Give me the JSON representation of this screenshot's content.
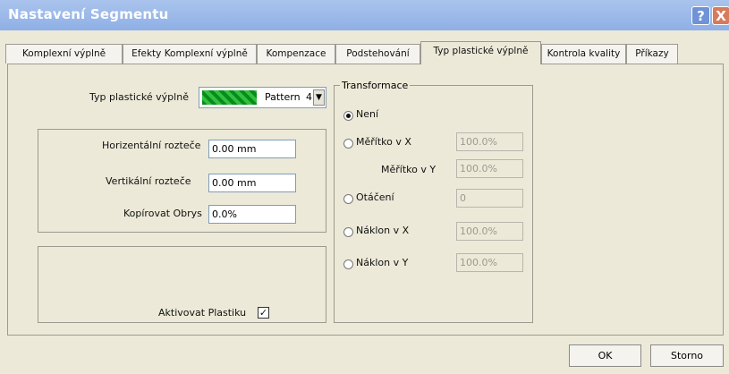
{
  "window": {
    "title": "Nastavení Segmentu",
    "help_label": "?",
    "close_label": "X"
  },
  "tabs": [
    {
      "label": "Komplexní výplně"
    },
    {
      "label": "Efekty Komplexní výplně"
    },
    {
      "label": "Kompenzace"
    },
    {
      "label": "Podstehování"
    },
    {
      "label": "Typ plastické výplně"
    },
    {
      "label": "Kontrola kvality"
    },
    {
      "label": "Příkazy"
    }
  ],
  "fill_type": {
    "label": "Typ plastické výplně",
    "value": "Pattern",
    "number": "4"
  },
  "spacing": {
    "horizontal_label": "Horizentální rozteče",
    "horizontal_value": "0.00 mm",
    "vertical_label": "Vertikální rozteče",
    "vertical_value": "0.00 mm",
    "copy_label": "Kopírovat Obrys",
    "copy_value": "0.0%"
  },
  "activate": {
    "label": "Aktivovat Plastiku",
    "checked": true
  },
  "transform": {
    "legend": "Transformace",
    "options": [
      {
        "label": "Není",
        "checked": true
      },
      {
        "label": "Měřítko v X",
        "value": "100.0%"
      },
      {
        "label": "Měřítko v Y",
        "value": "100.0%"
      },
      {
        "label": "Otáčení",
        "value": "0"
      },
      {
        "label": "Náklon v X",
        "value": "100.0%"
      },
      {
        "label": "Náklon v Y",
        "value": "100.0%"
      }
    ]
  },
  "buttons": {
    "ok": "OK",
    "cancel": "Storno"
  }
}
